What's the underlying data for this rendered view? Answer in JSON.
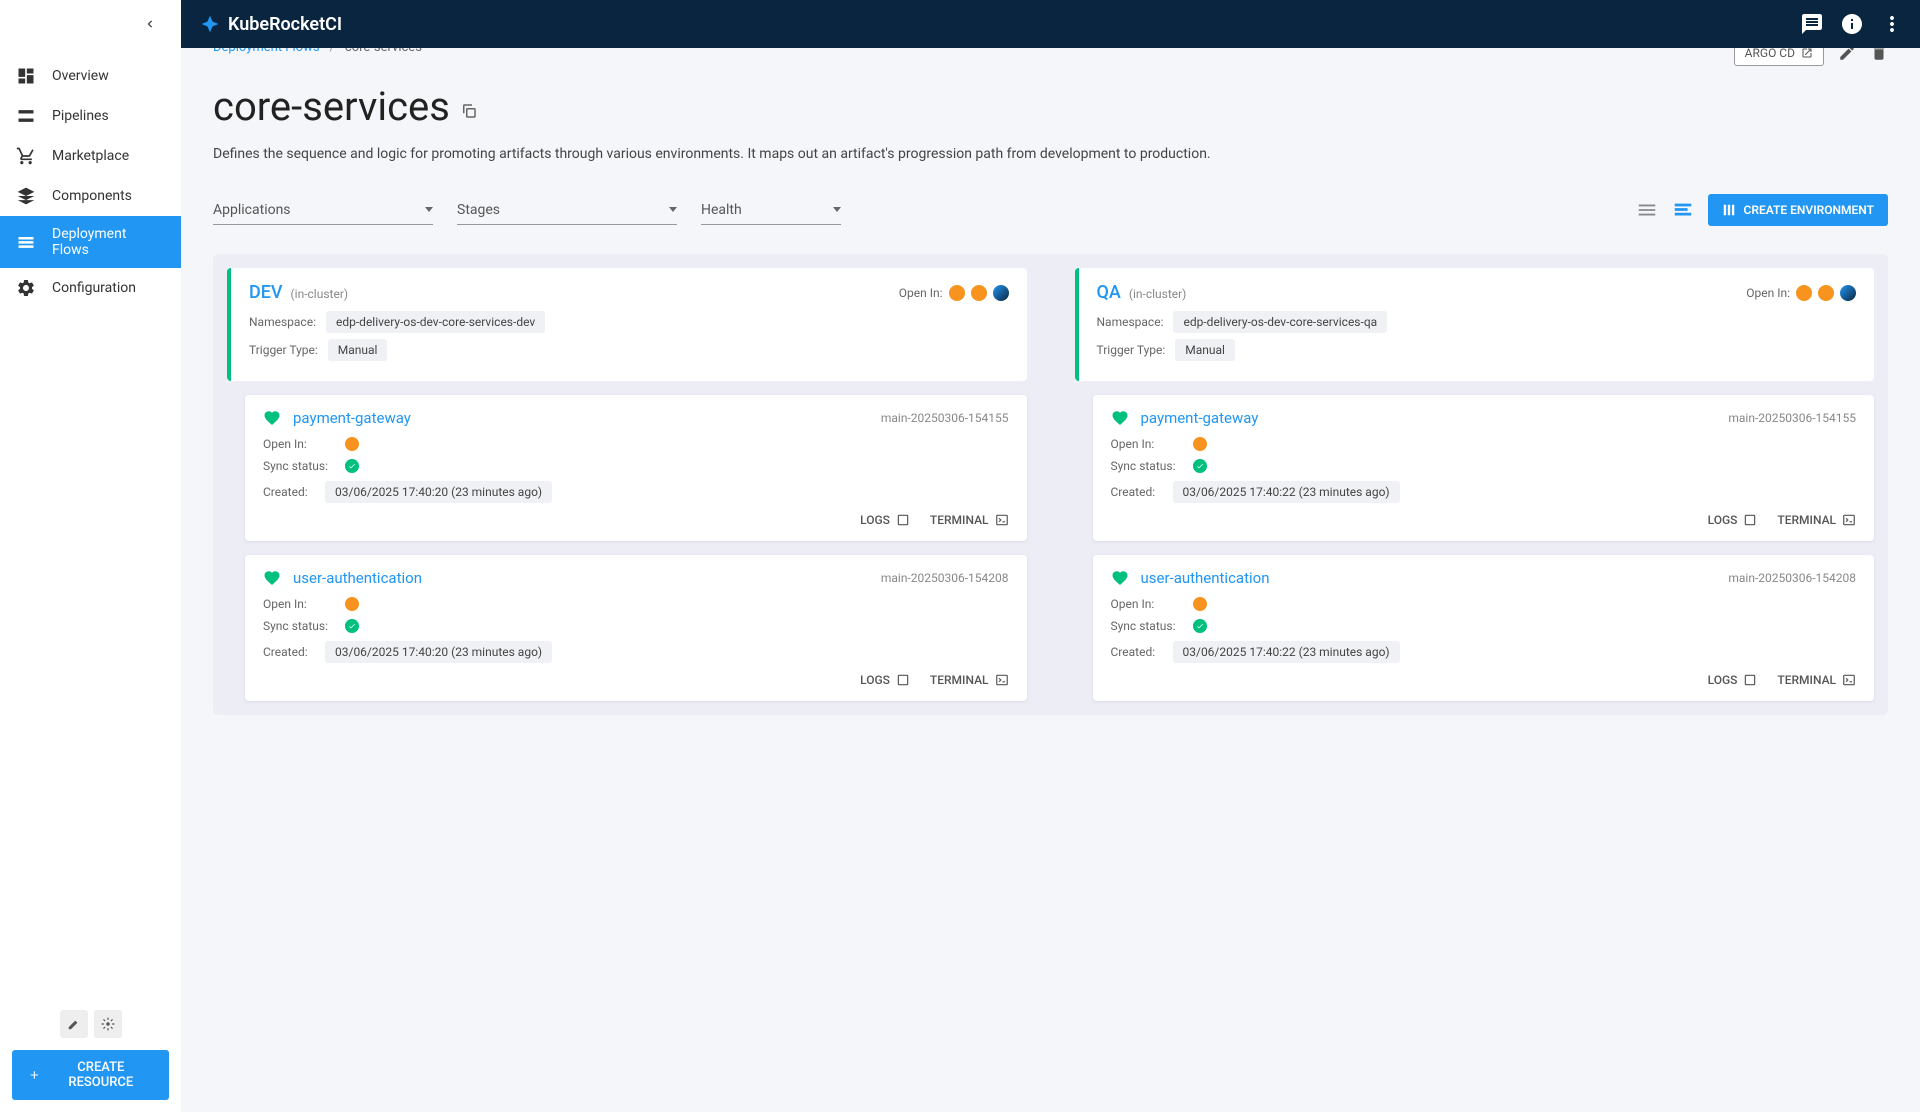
{
  "app": {
    "name": "KubeRocketCI"
  },
  "sidebar": {
    "items": [
      {
        "label": "Overview"
      },
      {
        "label": "Pipelines"
      },
      {
        "label": "Marketplace"
      },
      {
        "label": "Components"
      },
      {
        "label": "Deployment Flows"
      },
      {
        "label": "Configuration"
      }
    ],
    "create_resource": "CREATE RESOURCE"
  },
  "breadcrumb": {
    "parent": "Deployment Flows",
    "current": "core-services"
  },
  "page": {
    "title": "core-services",
    "description": "Defines the sequence and logic for promoting artifacts through various environments. It maps out an artifact's progression path from development to production.",
    "argo_button": "ARGO CD",
    "create_env": "CREATE ENVIRONMENT"
  },
  "filters": {
    "applications": "Applications",
    "stages": "Stages",
    "health": "Health"
  },
  "labels": {
    "open_in": "Open In:",
    "namespace": "Namespace:",
    "trigger_type": "Trigger Type:",
    "sync_status": "Sync status:",
    "created": "Created:",
    "logs": "LOGS",
    "terminal": "TERMINAL"
  },
  "stages": [
    {
      "name": "DEV",
      "cluster": "(in-cluster)",
      "namespace": "edp-delivery-os-dev-core-services-dev",
      "trigger": "Manual",
      "apps": [
        {
          "name": "payment-gateway",
          "version": "main-20250306-154155",
          "created": "03/06/2025 17:40:20 (23 minutes ago)"
        },
        {
          "name": "user-authentication",
          "version": "main-20250306-154208",
          "created": "03/06/2025 17:40:20 (23 minutes ago)"
        }
      ]
    },
    {
      "name": "QA",
      "cluster": "(in-cluster)",
      "namespace": "edp-delivery-os-dev-core-services-qa",
      "trigger": "Manual",
      "apps": [
        {
          "name": "payment-gateway",
          "version": "main-20250306-154155",
          "created": "03/06/2025 17:40:22 (23 minutes ago)"
        },
        {
          "name": "user-authentication",
          "version": "main-20250306-154208",
          "created": "03/06/2025 17:40:22 (23 minutes ago)"
        }
      ]
    }
  ]
}
